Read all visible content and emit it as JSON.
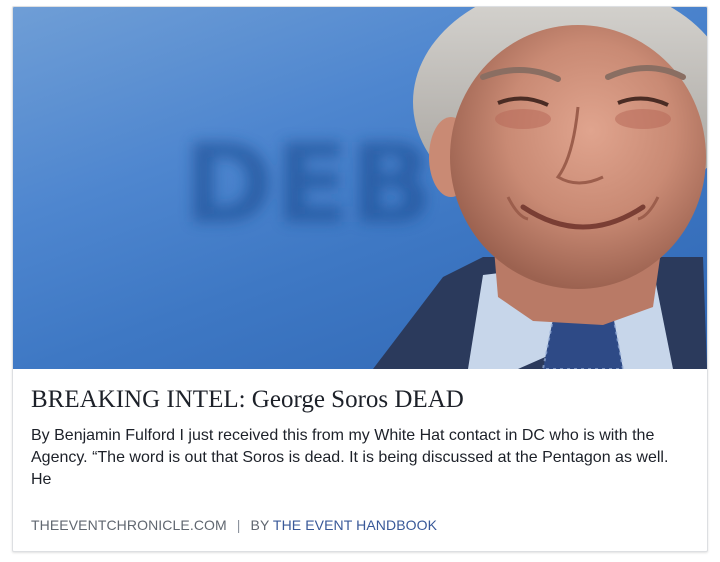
{
  "card": {
    "headline": "BREAKING INTEL: George Soros DEAD",
    "description": "By Benjamin Fulford I just received this from my White Hat contact in DC who is with the Agency. “The word is out that Soros is dead. It is being discussed at the Pentagon as well. He",
    "source_domain": "THEEVENTCHRONICLE.COM",
    "separator": "|",
    "byline_prefix": "BY",
    "byline_author": "THE EVENT HANDBOOK",
    "background_text": "DEB"
  },
  "colors": {
    "background_blue": "#3e78c4",
    "link_blue": "#385898",
    "meta_gray": "#606770",
    "text_dark": "#1d2129"
  }
}
